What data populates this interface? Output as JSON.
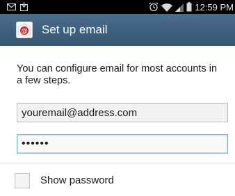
{
  "status_bar": {
    "time": "12:59 PM",
    "left_icons": [
      "email-notification-icon",
      "download-notification-icon"
    ],
    "right_icons": [
      "alarm-icon",
      "wifi-icon",
      "signal-icon",
      "battery-icon"
    ]
  },
  "action_bar": {
    "icon": "email-app-icon",
    "title": "Set up email"
  },
  "form": {
    "intro": "You can configure email for most accounts in a few steps.",
    "email_value": "youremail@address.com",
    "password_value": "••••••",
    "show_password_label": "Show password",
    "show_password_checked": false
  },
  "colors": {
    "action_bar": "#3e5f7b",
    "status_bar": "#000000",
    "focus_border": "#7fb3d5"
  }
}
